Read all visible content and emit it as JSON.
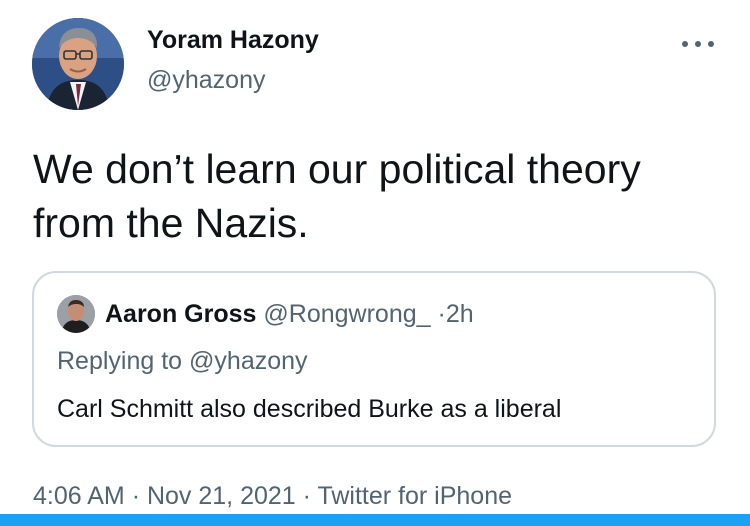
{
  "author": {
    "name": "Yoram Hazony",
    "handle": "@yhazony",
    "avatar_icon": "avatar-photo"
  },
  "more_icon": "more-horizontal-icon",
  "tweet": {
    "text_line1": "We don’t learn our political theory",
    "text_line2": "from the Nazis."
  },
  "quote": {
    "name": "Aaron Gross",
    "handle": "@Rongwrong_",
    "separator": "·",
    "time": "2h",
    "reply_prefix": "Replying to",
    "reply_handle": "@yhazony",
    "text": "Carl Schmitt also described Burke as a liberal"
  },
  "meta": {
    "time": "4:06 AM",
    "separator": "·",
    "date": "Nov 21, 2021",
    "source": "Twitter for iPhone"
  },
  "colors": {
    "text": "#0f1419",
    "secondary": "#536471",
    "border": "#cfd9de",
    "accent": "#1da1f2"
  }
}
